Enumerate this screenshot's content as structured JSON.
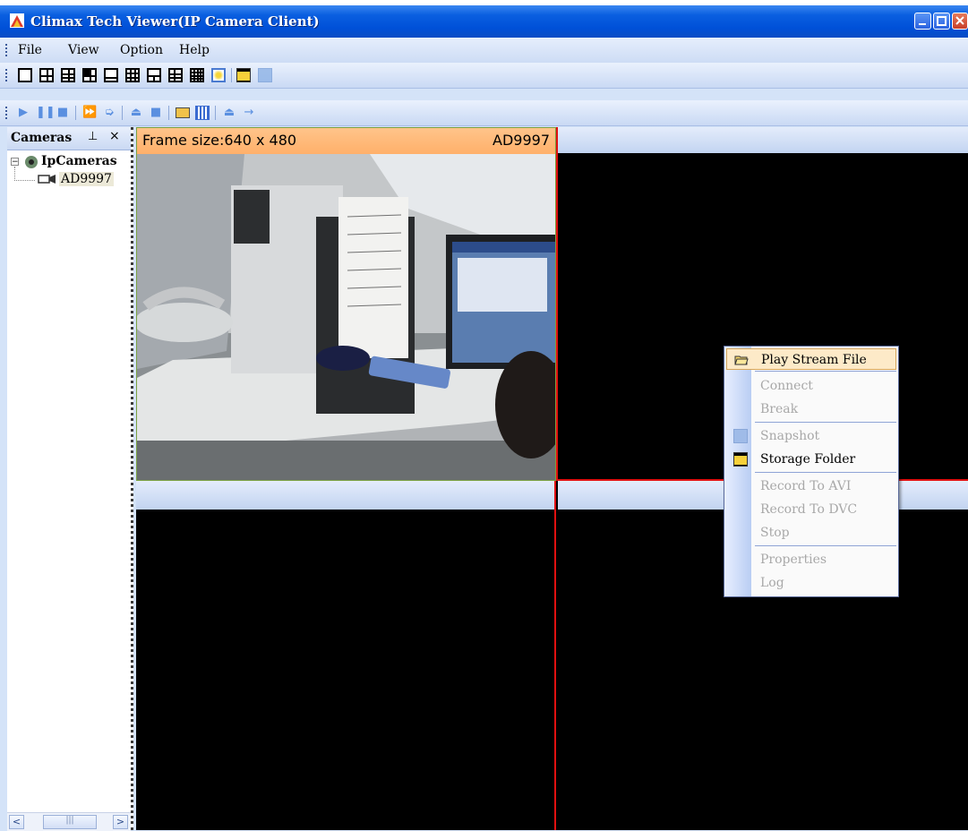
{
  "window": {
    "title": "Climax Tech Viewer(IP Camera Client)"
  },
  "menubar": [
    "File",
    "View",
    "Option",
    "Help"
  ],
  "cameras_panel": {
    "title": "Cameras",
    "pin_glyph": "$",
    "close_glyph": "×",
    "tree": {
      "root": "IpCameras",
      "child": "AD9997"
    },
    "scroll_thumb": "|||"
  },
  "video": {
    "cell1": {
      "frame_size": "Frame size:640 x 480",
      "camera": "AD9997"
    }
  },
  "context_menu": {
    "items": [
      {
        "label": "Play Stream File",
        "enabled": true,
        "highlighted": true,
        "icon": "open-folder-icon"
      },
      {
        "label": "Connect",
        "enabled": false
      },
      {
        "label": "Break",
        "enabled": false
      },
      {
        "label": "Snapshot",
        "enabled": false,
        "icon": "snapshot-icon"
      },
      {
        "label": "Storage Folder",
        "enabled": true,
        "icon": "storage-folder-icon"
      },
      {
        "label": "Record To AVI",
        "enabled": false
      },
      {
        "label": "Record To DVC",
        "enabled": false
      },
      {
        "label": "Stop",
        "enabled": false
      },
      {
        "label": "Properties",
        "enabled": false
      },
      {
        "label": "Log",
        "enabled": false
      }
    ]
  },
  "colors": {
    "title_bar": "#0050d8",
    "active_cell_header": "#ffb06a",
    "selected_cell_border": "#e01010",
    "highlight": "#fdeac8"
  }
}
